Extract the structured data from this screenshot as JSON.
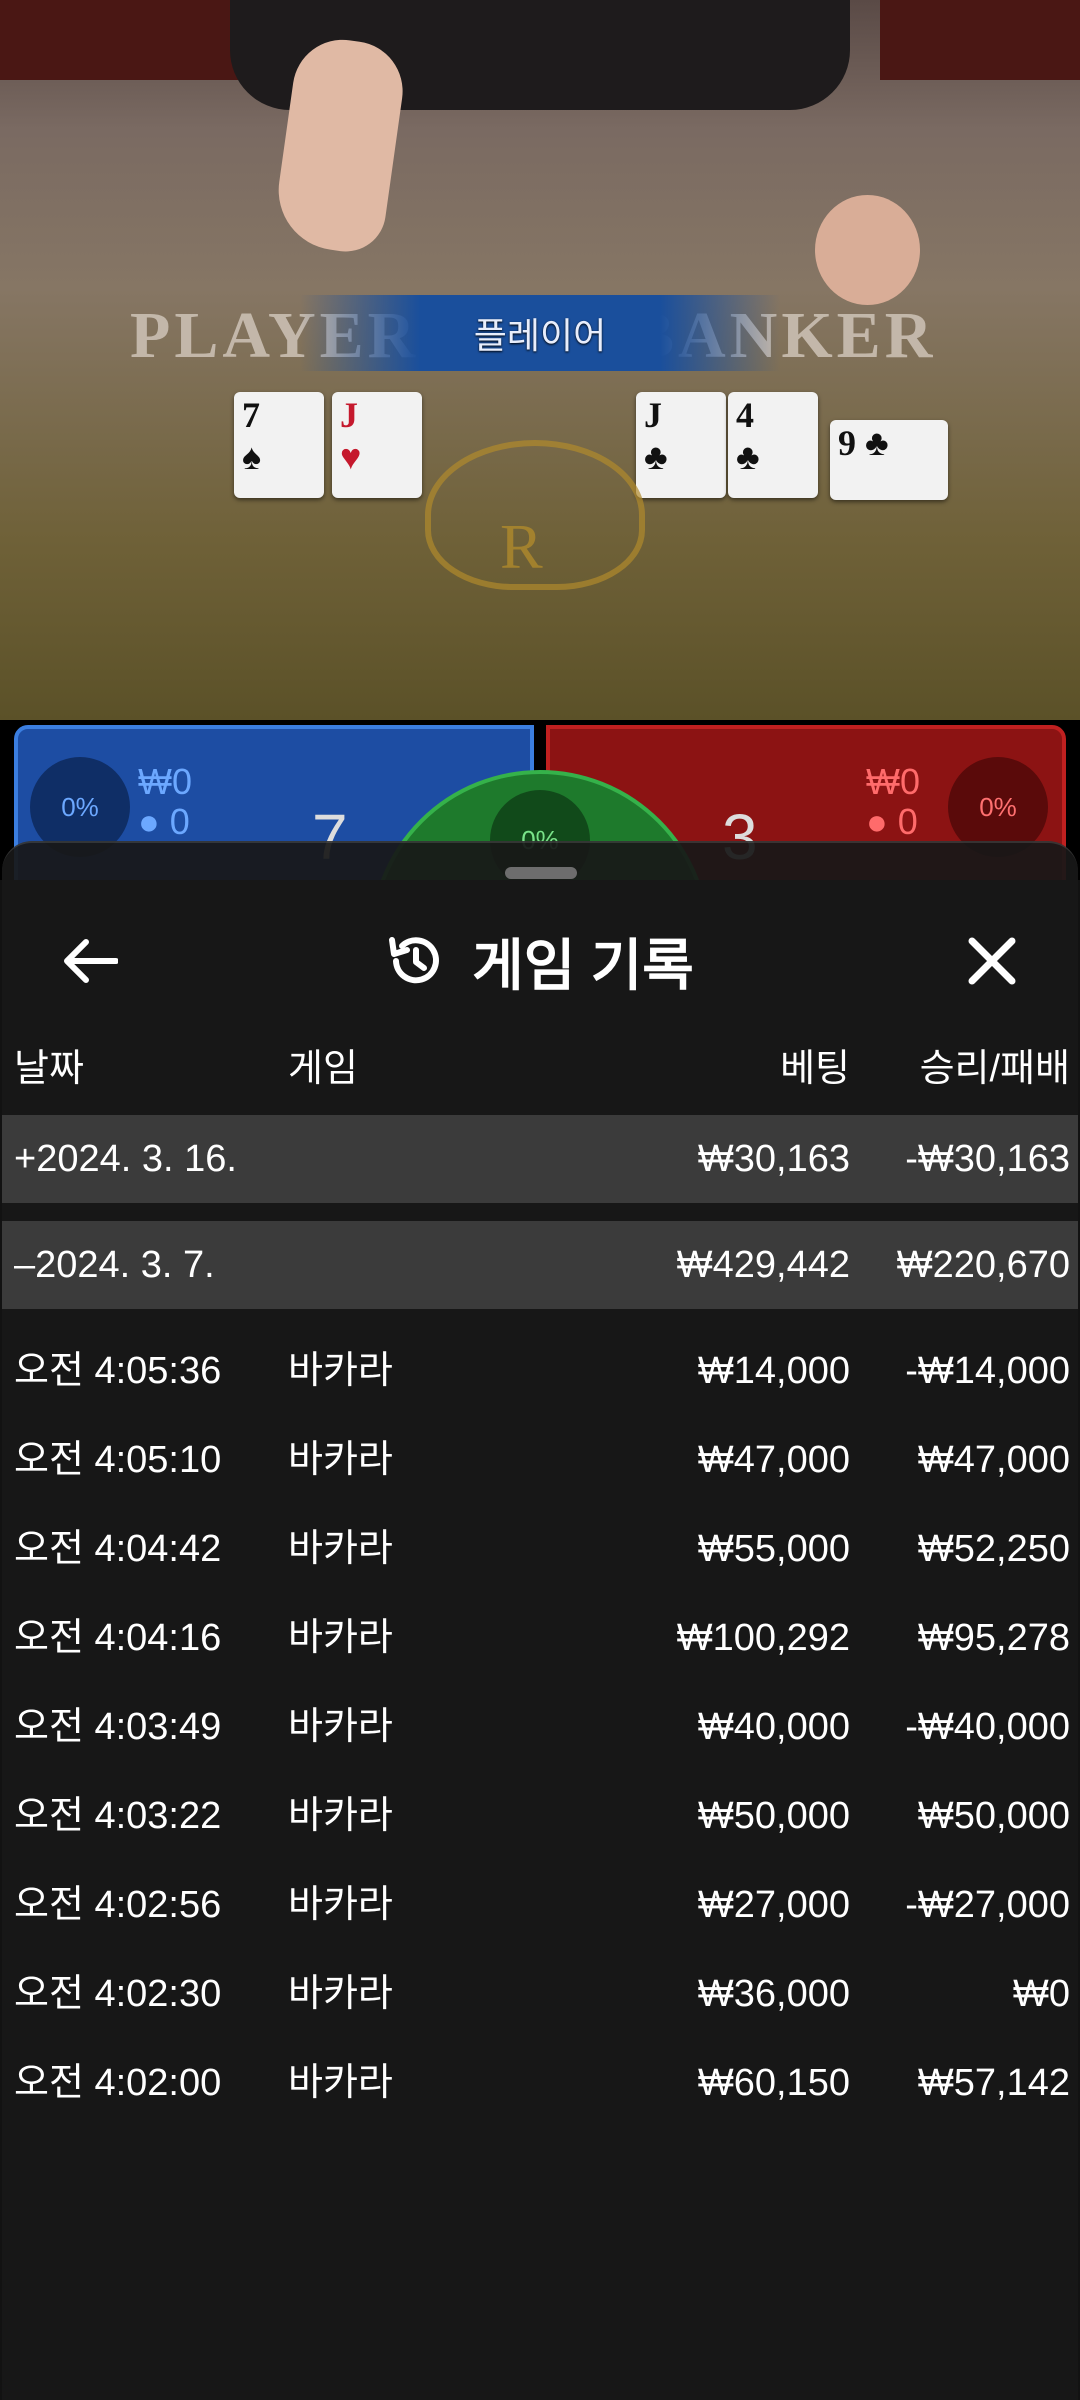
{
  "scene": {
    "player_word": "PLAYER",
    "banker_word": "BANKER",
    "player_banner": "플레이어",
    "player_cards": [
      {
        "rank": "7",
        "suit": "♠",
        "color": "blk"
      },
      {
        "rank": "J",
        "suit": "♥",
        "color": "red"
      }
    ],
    "banker_cards": [
      {
        "rank": "J",
        "suit": "♣",
        "color": "blk"
      },
      {
        "rank": "4",
        "suit": "♣",
        "color": "blk"
      },
      {
        "rank": "9",
        "suit": "♣",
        "color": "blk"
      }
    ],
    "crown_letter": "R",
    "player_pct": "0%",
    "banker_pct": "0%",
    "tie_pct": "0%",
    "player_stake": "₩0",
    "player_count": "0",
    "banker_stake": "₩0",
    "banker_count": "0",
    "player_score": "7",
    "banker_score": "3"
  },
  "sheet": {
    "title": "게임 기록",
    "columns": {
      "date": "날짜",
      "game": "게임",
      "bet": "베팅",
      "win_loss": "승리/패배"
    },
    "rows": [
      {
        "kind": "group",
        "date": "+2024. 3. 16.",
        "game": "",
        "bet": "₩30,163",
        "win_loss": "-₩30,163"
      },
      {
        "kind": "group",
        "date": "–2024. 3. 7.",
        "game": "",
        "bet": "₩429,442",
        "win_loss": "₩220,670"
      },
      {
        "kind": "item",
        "date": "오전 4:05:36",
        "game": "바카라",
        "bet": "₩14,000",
        "win_loss": "-₩14,000"
      },
      {
        "kind": "item",
        "date": "오전 4:05:10",
        "game": "바카라",
        "bet": "₩47,000",
        "win_loss": "₩47,000"
      },
      {
        "kind": "item",
        "date": "오전 4:04:42",
        "game": "바카라",
        "bet": "₩55,000",
        "win_loss": "₩52,250"
      },
      {
        "kind": "item",
        "date": "오전 4:04:16",
        "game": "바카라",
        "bet": "₩100,292",
        "win_loss": "₩95,278"
      },
      {
        "kind": "item",
        "date": "오전 4:03:49",
        "game": "바카라",
        "bet": "₩40,000",
        "win_loss": "-₩40,000"
      },
      {
        "kind": "item",
        "date": "오전 4:03:22",
        "game": "바카라",
        "bet": "₩50,000",
        "win_loss": "₩50,000"
      },
      {
        "kind": "item",
        "date": "오전 4:02:56",
        "game": "바카라",
        "bet": "₩27,000",
        "win_loss": "-₩27,000"
      },
      {
        "kind": "item",
        "date": "오전 4:02:30",
        "game": "바카라",
        "bet": "₩36,000",
        "win_loss": "₩0"
      },
      {
        "kind": "item",
        "date": "오전 4:02:00",
        "game": "바카라",
        "bet": "₩60,150",
        "win_loss": "₩57,142"
      }
    ]
  },
  "icons": {
    "back": "arrow-left-icon",
    "history": "history-icon",
    "close": "close-icon"
  }
}
